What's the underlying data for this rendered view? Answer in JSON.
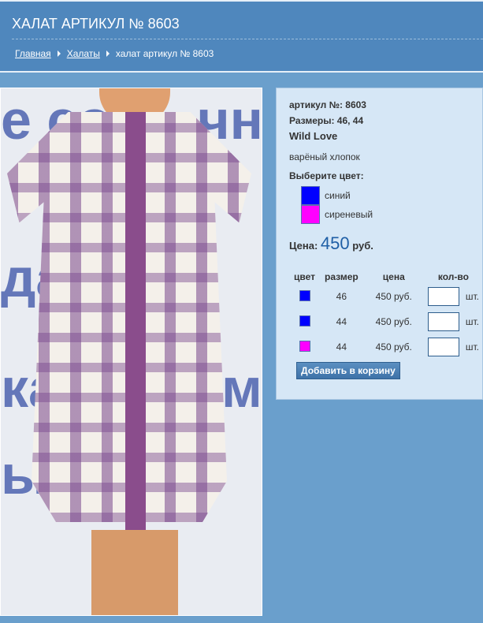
{
  "header": {
    "title": "ХАЛАТ АРТИКУЛ № 8603",
    "breadcrumbs": [
      {
        "label": "Главная"
      },
      {
        "label": "Халаты"
      },
      {
        "label": "халат артикул № 8603"
      }
    ]
  },
  "product": {
    "article": "артикул №: 8603",
    "sizes": "Размеры: 46, 44",
    "brand": "Wild Love",
    "material": "варёный хлопок",
    "choose_color": "Выберите цвет:",
    "colors": [
      {
        "name": "синий",
        "hex": "#0000ff"
      },
      {
        "name": "сиреневый",
        "hex": "#ff00ff"
      }
    ],
    "price_label": "Цена:",
    "price": "450",
    "currency": "руб."
  },
  "table": {
    "headers": [
      "цвет",
      "размер",
      "цена",
      "кол-во"
    ],
    "rows": [
      {
        "color": "#0000ff",
        "size": "46",
        "price": "450 руб.",
        "unit": "шт."
      },
      {
        "color": "#0000ff",
        "size": "44",
        "price": "450 руб.",
        "unit": "шт."
      },
      {
        "color": "#ff00ff",
        "size": "44",
        "price": "450 руб.",
        "unit": "шт."
      }
    ]
  },
  "add_to_cart": "Добавить в корзину"
}
